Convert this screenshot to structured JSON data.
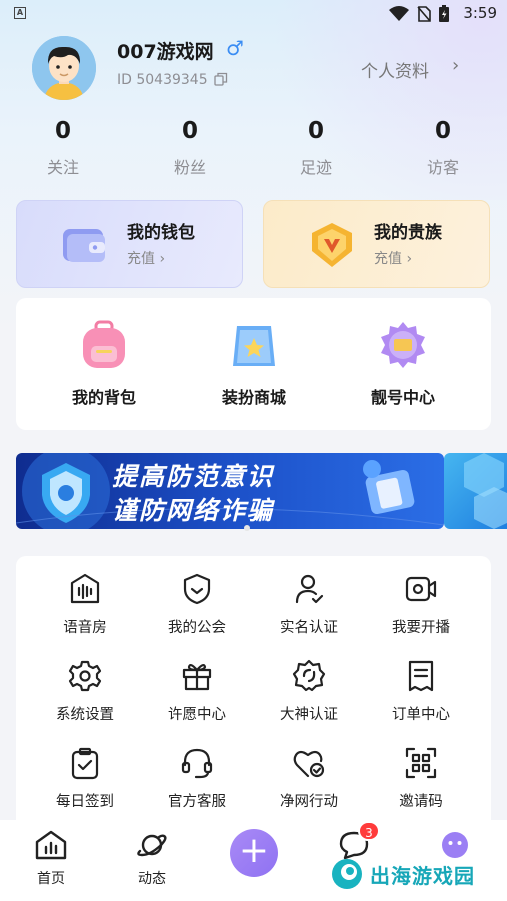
{
  "status_bar": {
    "indicator": "A",
    "time": "3:59"
  },
  "profile": {
    "username": "007游戏网",
    "gender_symbol": "♂",
    "user_id": "ID 50439345",
    "profile_link": "个人资料",
    "chevron": "›"
  },
  "stats": [
    {
      "value": "0",
      "label": "关注"
    },
    {
      "value": "0",
      "label": "粉丝"
    },
    {
      "value": "0",
      "label": "足迹"
    },
    {
      "value": "0",
      "label": "访客"
    }
  ],
  "cards": {
    "wallet": {
      "title": "我的钱包",
      "action": "充值  ›"
    },
    "noble": {
      "title": "我的贵族",
      "action": "充值  ›"
    }
  },
  "featured": [
    {
      "label": "我的背包",
      "icon": "backpack-icon"
    },
    {
      "label": "装扮商城",
      "icon": "shopping-bag-icon"
    },
    {
      "label": "靓号中心",
      "icon": "id-badge-icon"
    }
  ],
  "banner": {
    "line1": "提高防范意识",
    "line2": "谨防网络诈骗"
  },
  "services": [
    {
      "label": "语音房",
      "icon": "voice-room-icon"
    },
    {
      "label": "我的公会",
      "icon": "guild-shield-icon"
    },
    {
      "label": "实名认证",
      "icon": "verify-user-icon"
    },
    {
      "label": "我要开播",
      "icon": "video-camera-icon"
    },
    {
      "label": "系统设置",
      "icon": "gear-icon"
    },
    {
      "label": "许愿中心",
      "icon": "gift-box-icon"
    },
    {
      "label": "大神认证",
      "icon": "badge-certify-icon"
    },
    {
      "label": "订单中心",
      "icon": "order-list-icon"
    },
    {
      "label": "每日签到",
      "icon": "clipboard-check-icon"
    },
    {
      "label": "官方客服",
      "icon": "headset-icon"
    },
    {
      "label": "净网行动",
      "icon": "heart-shield-icon"
    },
    {
      "label": "邀请码",
      "icon": "qr-scan-icon"
    }
  ],
  "bottom_nav": {
    "home": "首页",
    "feed": "动态",
    "plus": "+",
    "message_badge": "3"
  },
  "watermark": "出海游戏园",
  "colors": {
    "accent_purple": "#9b7ff4",
    "badge_red": "#ff3b3b",
    "gender_blue": "#3a8df3",
    "watermark_teal": "#17a7b8"
  }
}
